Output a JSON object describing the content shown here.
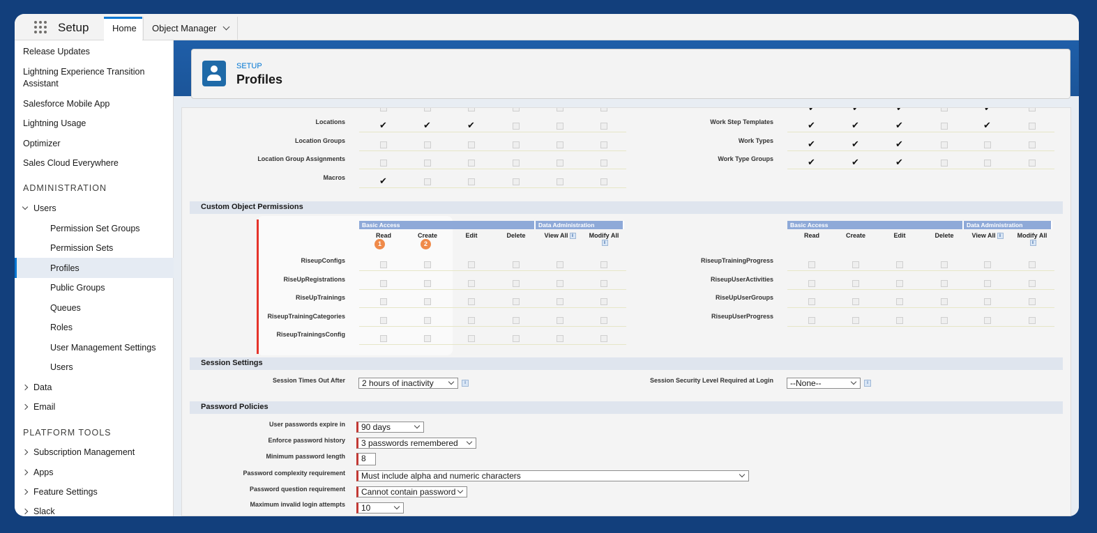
{
  "topbar": {
    "app_name": "Setup",
    "tabs": [
      {
        "label": "Home"
      },
      {
        "label": "Object Manager"
      }
    ]
  },
  "sidebar": {
    "items_top": [
      "Release Updates",
      "Lightning Experience Transition Assistant",
      "Salesforce Mobile App",
      "Lightning Usage",
      "Optimizer",
      "Sales Cloud Everywhere"
    ],
    "section_admin": "ADMINISTRATION",
    "users_group": "Users",
    "users_children": [
      "Permission Set Groups",
      "Permission Sets",
      "Profiles",
      "Public Groups",
      "Queues",
      "Roles",
      "User Management Settings",
      "Users"
    ],
    "collapsed_1": [
      "Data",
      "Email"
    ],
    "section_platform": "PLATFORM TOOLS",
    "collapsed_2": [
      "Subscription Management",
      "Apps",
      "Feature Settings",
      "Slack"
    ]
  },
  "header": {
    "breadcrumb": "SETUP",
    "title": "Profiles"
  },
  "std_objects": {
    "left": [
      {
        "name": "Locations",
        "checks": [
          true,
          true,
          true,
          false,
          false,
          false
        ]
      },
      {
        "name": "Location Groups",
        "checks": [
          false,
          false,
          false,
          false,
          false,
          false
        ]
      },
      {
        "name": "Location Group Assignments",
        "checks": [
          false,
          false,
          false,
          false,
          false,
          false
        ]
      },
      {
        "name": "Macros",
        "checks": [
          true,
          false,
          false,
          false,
          false,
          false
        ]
      }
    ],
    "right": [
      {
        "name": "Work Step Templates",
        "checks": [
          true,
          true,
          true,
          false,
          true,
          false
        ]
      },
      {
        "name": "Work Types",
        "checks": [
          true,
          true,
          true,
          false,
          false,
          false
        ]
      },
      {
        "name": "Work Type Groups",
        "checks": [
          true,
          true,
          true,
          false,
          false,
          false
        ]
      }
    ]
  },
  "custom_objects": {
    "section_title": "Custom Object Permissions",
    "group_basic": "Basic Access",
    "group_admin": "Data Administration",
    "columns": [
      "Read",
      "Create",
      "Edit",
      "Delete",
      "View All",
      "Modify All"
    ],
    "step_markers": [
      "1",
      "2"
    ],
    "left_objects": [
      "RiseupConfigs",
      "RiseUpRegistrations",
      "RiseUpTrainings",
      "RiseupTrainingCategories",
      "RiseupTrainingsConfig"
    ],
    "right_objects": [
      "RiseupTrainingProgress",
      "RiseupUserActivities",
      "RiseUpUserGroups",
      "RiseupUserProgress"
    ]
  },
  "session": {
    "section_title": "Session Settings",
    "timeout_label": "Session Times Out After",
    "timeout_value": "2 hours of inactivity",
    "security_label": "Session Security Level Required at Login",
    "security_value": "--None--"
  },
  "password": {
    "section_title": "Password Policies",
    "fields": [
      {
        "label": "User passwords expire in",
        "value": "90 days"
      },
      {
        "label": "Enforce password history",
        "value": "3 passwords remembered"
      },
      {
        "label": "Minimum password length",
        "value": "8"
      },
      {
        "label": "Password complexity requirement",
        "value": "Must include alpha and numeric characters"
      },
      {
        "label": "Password question requirement",
        "value": "Cannot contain password"
      },
      {
        "label": "Maximum invalid login attempts",
        "value": "10"
      }
    ]
  },
  "colors": {
    "background": "#123f7c",
    "accent": "#0176d3",
    "required": "#c23934",
    "step_marker": "#ef8a4a",
    "highlight_bar": "#e5332a"
  }
}
